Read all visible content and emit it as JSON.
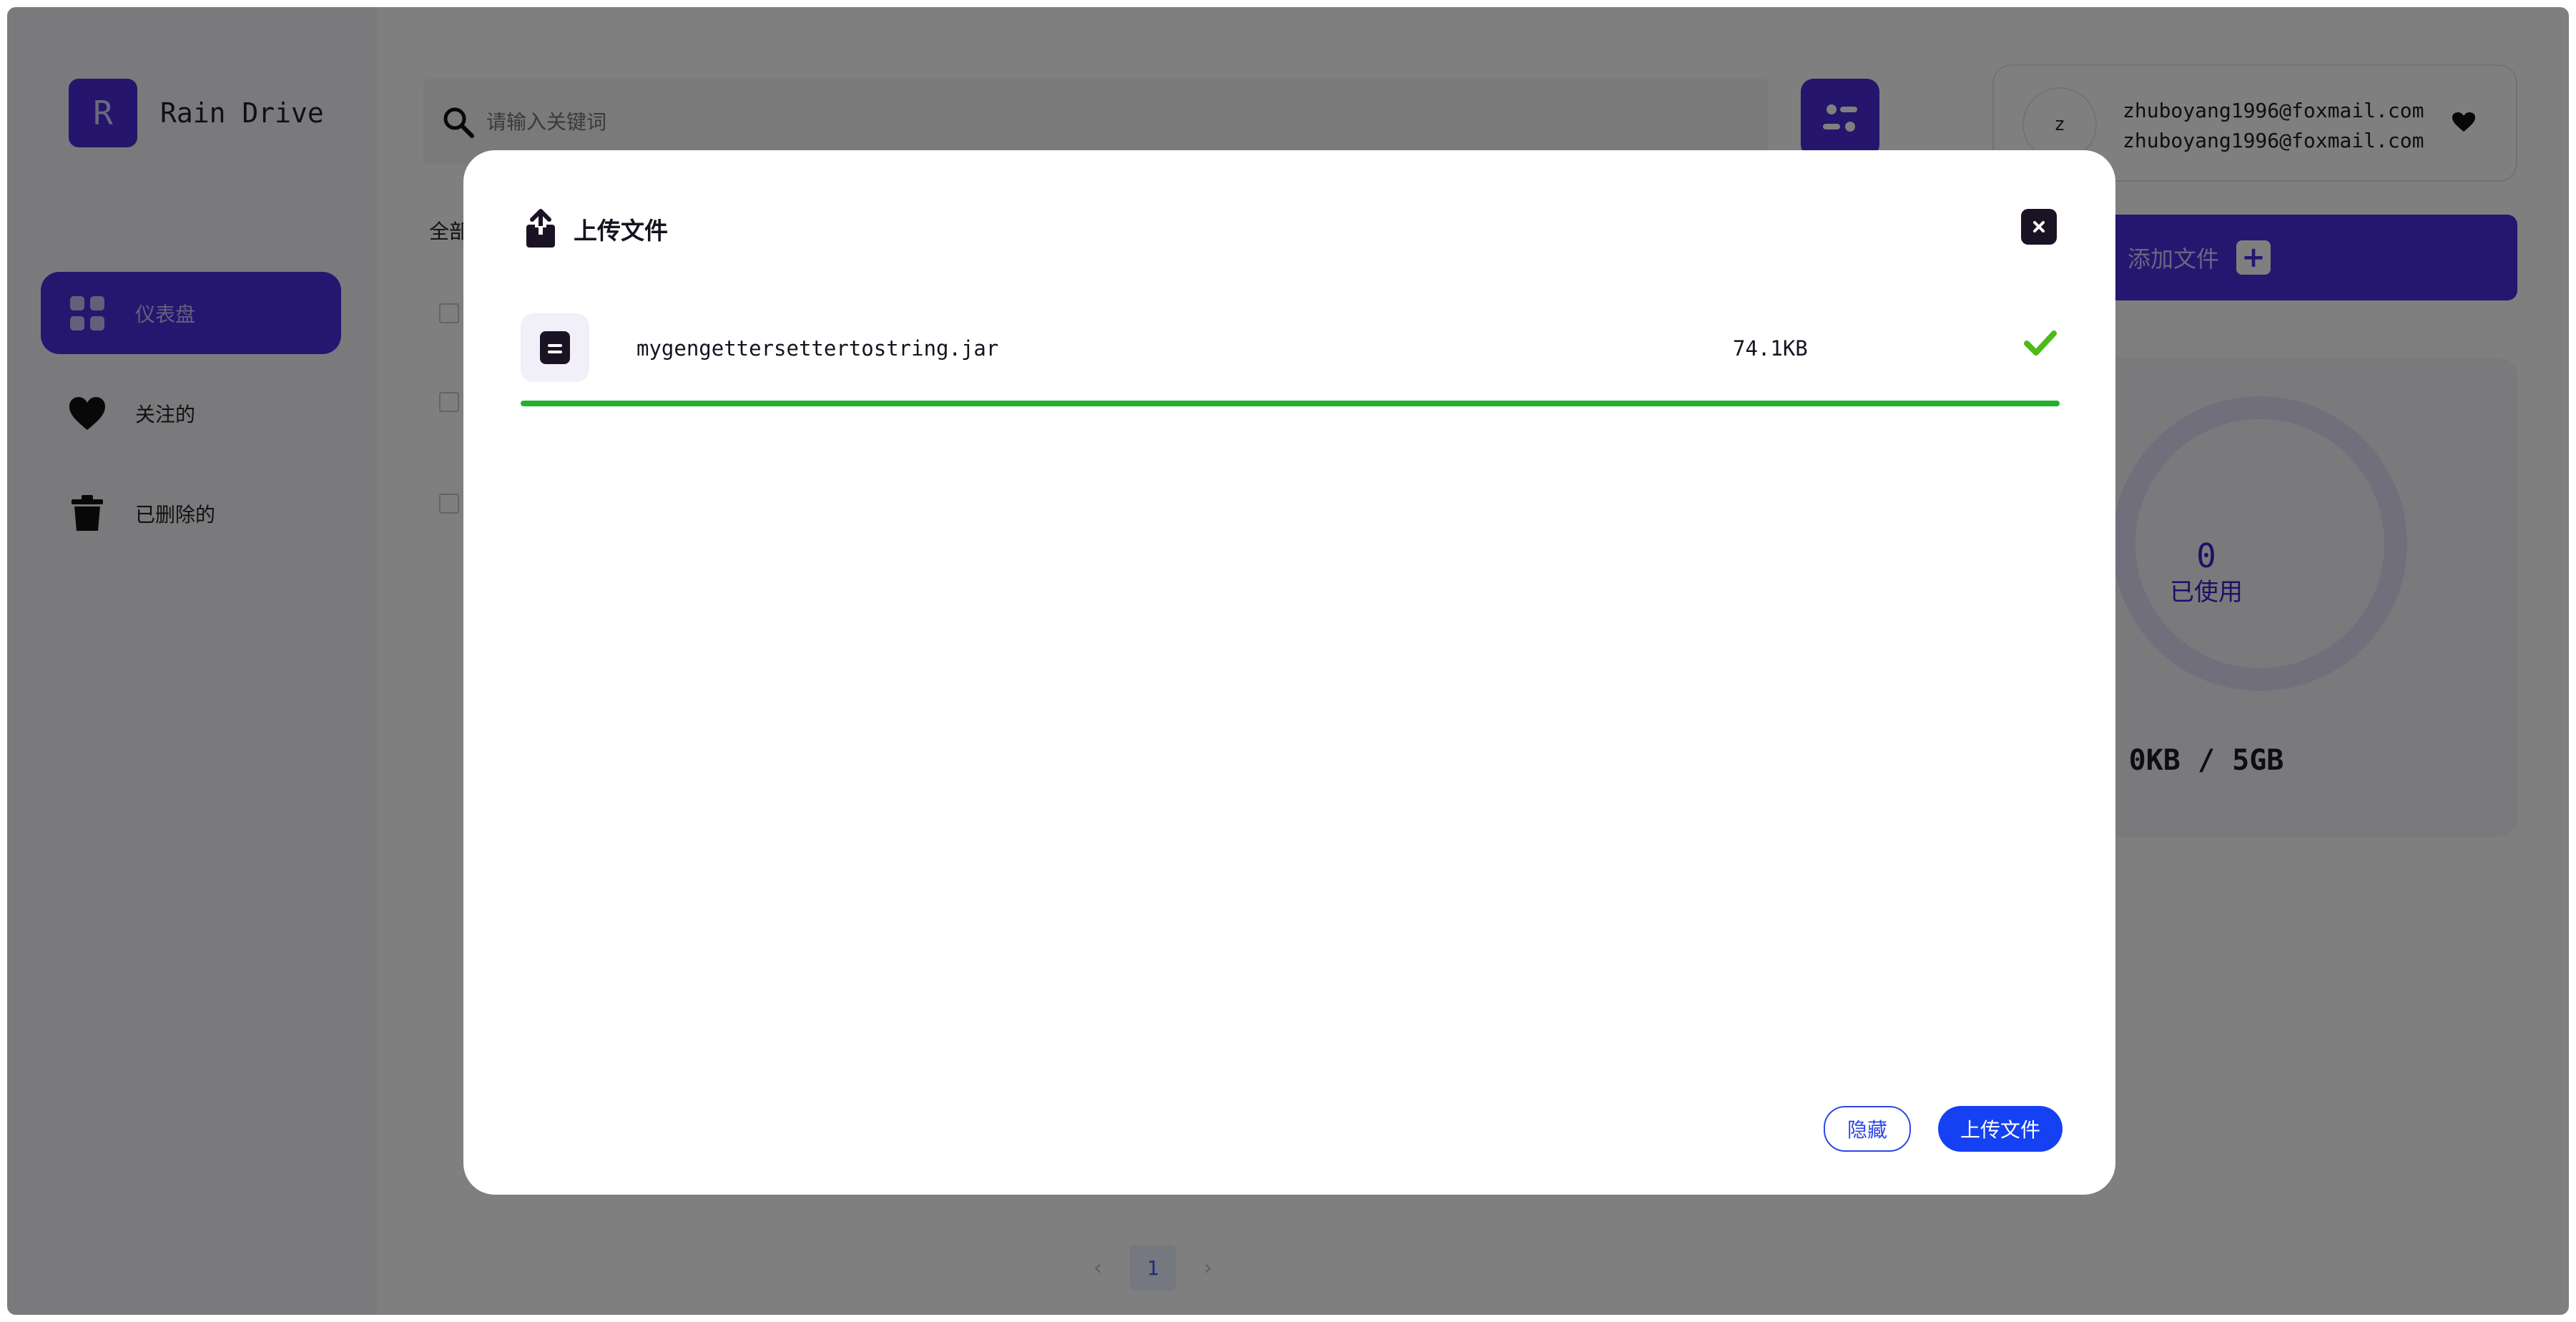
{
  "app": {
    "logo_letter": "R",
    "name": "Rain Drive"
  },
  "sidebar": {
    "items": [
      {
        "label": "仪表盘",
        "icon": "grid-icon",
        "active": true
      },
      {
        "label": "关注的",
        "icon": "heart-icon",
        "active": false
      },
      {
        "label": "已删除的",
        "icon": "trash-icon",
        "active": false
      }
    ]
  },
  "search": {
    "placeholder": "请输入关键词",
    "value": ""
  },
  "user": {
    "avatar_letter": "z",
    "name": "zhuboyang1996@foxmail.com",
    "email": "zhuboyang1996@foxmail.com"
  },
  "main": {
    "all_label": "全部",
    "add_file_label": "添加文件",
    "storage": {
      "used_number": "0",
      "used_label": "已使用",
      "quota": "0KB / 5GB"
    },
    "pagination": {
      "current_page": "1"
    }
  },
  "upload_modal": {
    "title": "上传文件",
    "files": [
      {
        "name": "mygengettersettertostring.jar",
        "size": "74.1KB",
        "progress": 1.0,
        "status": "complete"
      }
    ],
    "hide_button": "隐藏",
    "upload_button": "上传文件"
  },
  "colors": {
    "brand": "#4b2ee0",
    "progress": "#22b02e",
    "success_check": "#4cbb17",
    "primary_button": "#1541f2",
    "overlay": "rgba(0,0,0,0.5)"
  }
}
